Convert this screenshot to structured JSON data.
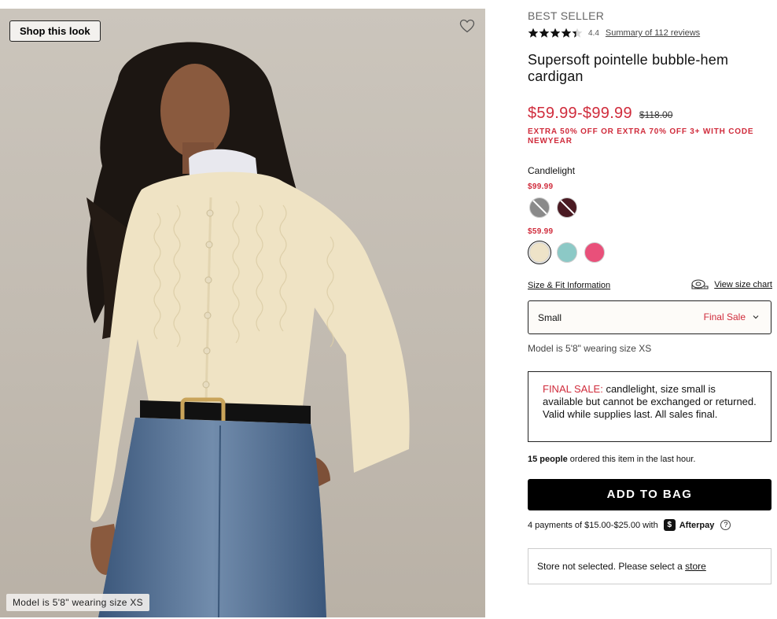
{
  "hero": {
    "shop_look_label": "Shop this look",
    "model_caption": "Model is 5'8\" wearing size XS"
  },
  "product": {
    "badge": "BEST SELLER",
    "rating": "4.4",
    "rating_value": 4.4,
    "reviews_link": "Summary of 112 reviews",
    "title": "Supersoft pointelle bubble-hem cardigan",
    "price_range": "$59.99-$99.99",
    "original_price": "$118.00",
    "promo": "EXTRA 50% OFF OR EXTRA 70% OFF 3+ WITH CODE NEWYEAR"
  },
  "colors": {
    "selected_name": "Candlelight",
    "tiers": [
      {
        "price": "$99.99",
        "swatches": [
          {
            "name": "grey-heather",
            "color": "#8a8a8a",
            "unavailable": true
          },
          {
            "name": "burgundy",
            "color": "#4a1a22",
            "unavailable": true
          }
        ]
      },
      {
        "price": "$59.99",
        "swatches": [
          {
            "name": "candlelight",
            "color": "#eee3c8",
            "selected": true
          },
          {
            "name": "aqua",
            "color": "#8cc9c6"
          },
          {
            "name": "pink",
            "color": "#e9507a"
          }
        ]
      }
    ]
  },
  "size": {
    "info_link": "Size & Fit Information",
    "chart_link": "View size chart",
    "selected": "Small",
    "status": "Final Sale",
    "model_note": "Model is 5'8\" wearing size XS"
  },
  "final_sale": {
    "label": "FINAL SALE:",
    "text": " candlelight, size small is available but cannot be exchanged or returned. Valid while supplies last. All sales final."
  },
  "social_proof": {
    "count": "15 people",
    "text": " ordered this item in the last hour."
  },
  "add_to_bag": "ADD TO BAG",
  "afterpay": {
    "text": "4 payments of $15.00-$25.00 with",
    "name": "Afterpay",
    "help": "?"
  },
  "store": {
    "text": "Store not selected. Please select a ",
    "link": "store"
  }
}
